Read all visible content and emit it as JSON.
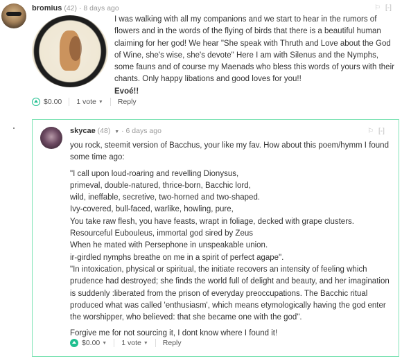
{
  "comment1": {
    "author": "bromius",
    "reputation": "(42)",
    "time": "8 days ago",
    "flag_icon": "flag-icon",
    "collapse_label": "[-]",
    "image_desc_icon": "dionysus-plate-image",
    "paragraph": "I was walking with all my companions and we start to hear in the rumors of flowers and in the words of the flying of birds that there is a beautiful human claiming for her god! We hear \"She speak with Thruth and Love about the God of Wine, she's wise, she's devote\" Here I am with Silenus and the Nymphs, some fauns and of course my Maenads who bless this words of yours with their chants. Only happy libations and good loves for you!!",
    "closing": "Evoé!!",
    "payout": "$0.00",
    "votes": "1 vote",
    "reply": "Reply"
  },
  "comment2": {
    "author": "skycae",
    "reputation": "(48)",
    "time": "6 days ago",
    "collapse_label": "[-]",
    "intro": "you rock, steemit version of Bacchus, your like my fav. How about this poem/hymm I found some time ago:",
    "poem_lines": [
      "\"I call upon loud-roaring and revelling Dionysus,",
      "primeval, double-natured, thrice-born, Bacchic lord,",
      "wild, ineffable, secretive, two-horned and two-shaped.",
      "Ivy-covered, bull-faced, warlike, howling, pure,",
      "You take raw flesh, you have feasts, wrapt in foliage, decked with grape clusters.",
      "Resourceful Eubouleus, immortal god sired by Zeus",
      "When he mated with Persephone in unspeakable union.",
      "ir-girdled nymphs breathe on me in a spirit of perfect agape\"."
    ],
    "quote": "\"In intoxication, physical or spiritual, the initiate recovers an intensity of feeling which prudence had destroyed; she finds the world full of delight and beauty, and her imagination is suddenly :liberated from the prison of everyday preoccupations. The Bacchic ritual produced what was called 'enthusiasm', which means etymologically having the god enter the worshipper, who believed: that she became one with the god\".",
    "closing": "Forgive me for not sourcing it, I dont know where I found it!",
    "payout": "$0.00",
    "votes": "1 vote",
    "reply": "Reply"
  },
  "colors": {
    "accent_green": "#1fbf8f",
    "box_border": "#7fe3b5"
  }
}
